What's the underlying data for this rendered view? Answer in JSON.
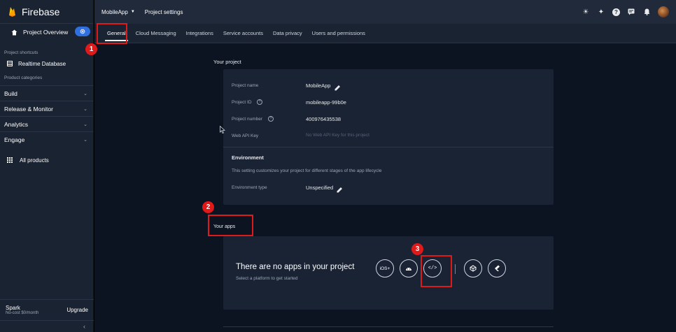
{
  "brand": {
    "name": "Firebase"
  },
  "sidebar": {
    "overview_label": "Project Overview",
    "shortcuts_header": "Project shortcuts",
    "shortcut_item": "Realtime Database",
    "categories_header": "Product categories",
    "categories": [
      "Build",
      "Release & Monitor",
      "Analytics",
      "Engage"
    ],
    "all_products": "All products",
    "plan_name": "Spark",
    "plan_sub": "No-cost $0/month",
    "upgrade_label": "Upgrade",
    "collapse_icon": "‹"
  },
  "topbar": {
    "app_name": "MobileApp",
    "page_title": "Project settings",
    "icons": [
      "brightness-icon",
      "sparkle-icon",
      "help-icon",
      "feedback-icon",
      "notifications-icon",
      "avatar"
    ]
  },
  "tabs": [
    "General",
    "Cloud Messaging",
    "Integrations",
    "Service accounts",
    "Data privacy",
    "Users and permissions"
  ],
  "project": {
    "section_title": "Your project",
    "name_label": "Project name",
    "name_value": "MobileApp",
    "id_label": "Project ID",
    "id_value": "mobileapp-99b0e",
    "number_label": "Project number",
    "number_value": "400976435538",
    "apikey_label": "Web API Key",
    "apikey_value": "No Web API Key for this project",
    "env_title": "Environment",
    "env_desc": "This setting customizes your project for different stages of the app lifecycle",
    "env_type_label": "Environment type",
    "env_type_value": "Unspecified"
  },
  "apps": {
    "section_title": "Your apps",
    "empty_title": "There are no apps in your project",
    "empty_sub": "Select a platform to get started",
    "platforms": [
      "iOS+",
      "android",
      "web",
      "unity",
      "flutter"
    ]
  },
  "annotations": [
    "1",
    "2",
    "3"
  ],
  "colors": {
    "accent": "#2f6fdf",
    "annotation": "#e0191a",
    "brand_flame": "#ffa000"
  }
}
